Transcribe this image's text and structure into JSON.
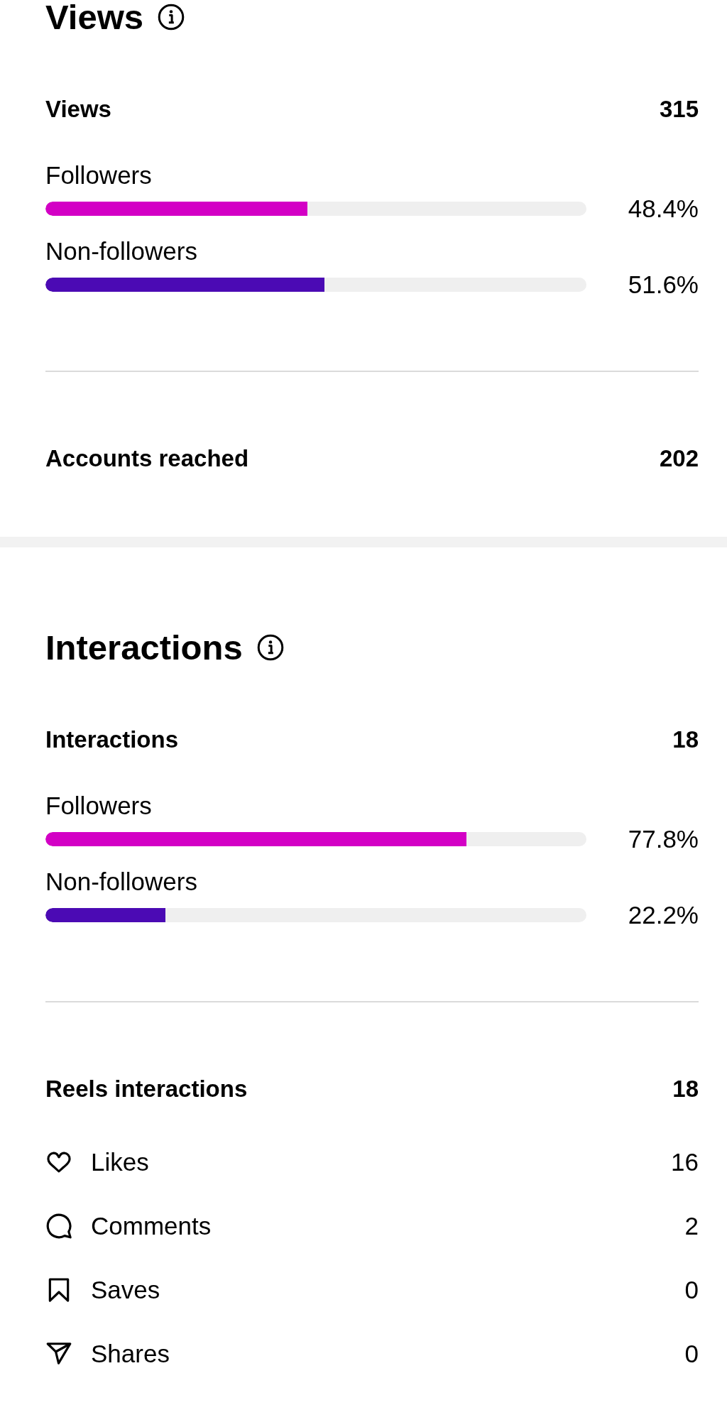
{
  "sections": [
    {
      "title": "Views",
      "total": {
        "label": "Views",
        "value": "315"
      },
      "breakdown": [
        {
          "label": "Followers",
          "color": "#d300c5",
          "level": 0.484,
          "reading": "48.4%"
        },
        {
          "label": "Non-followers",
          "color": "#4b0ab4",
          "level": 0.516,
          "reading": "51.6%"
        }
      ],
      "summary": {
        "label": "Accounts reached",
        "value": "202"
      }
    },
    {
      "title": "Interactions",
      "total": {
        "label": "Interactions",
        "value": "18"
      },
      "breakdown": [
        {
          "label": "Followers",
          "color": "#d300c5",
          "level": 0.778,
          "reading": "77.8%"
        },
        {
          "label": "Non-followers",
          "color": "#4b0ab4",
          "level": 0.222,
          "reading": "22.2%"
        }
      ],
      "summary": {
        "label": "Reels interactions",
        "value": "18"
      },
      "details": [
        {
          "kind": "likes",
          "label": "Likes",
          "value": "16"
        },
        {
          "kind": "comments",
          "label": "Comments",
          "value": "2"
        },
        {
          "kind": "saves",
          "label": "Saves",
          "value": "0"
        },
        {
          "kind": "shares",
          "label": "Shares",
          "value": "0"
        }
      ]
    }
  ]
}
